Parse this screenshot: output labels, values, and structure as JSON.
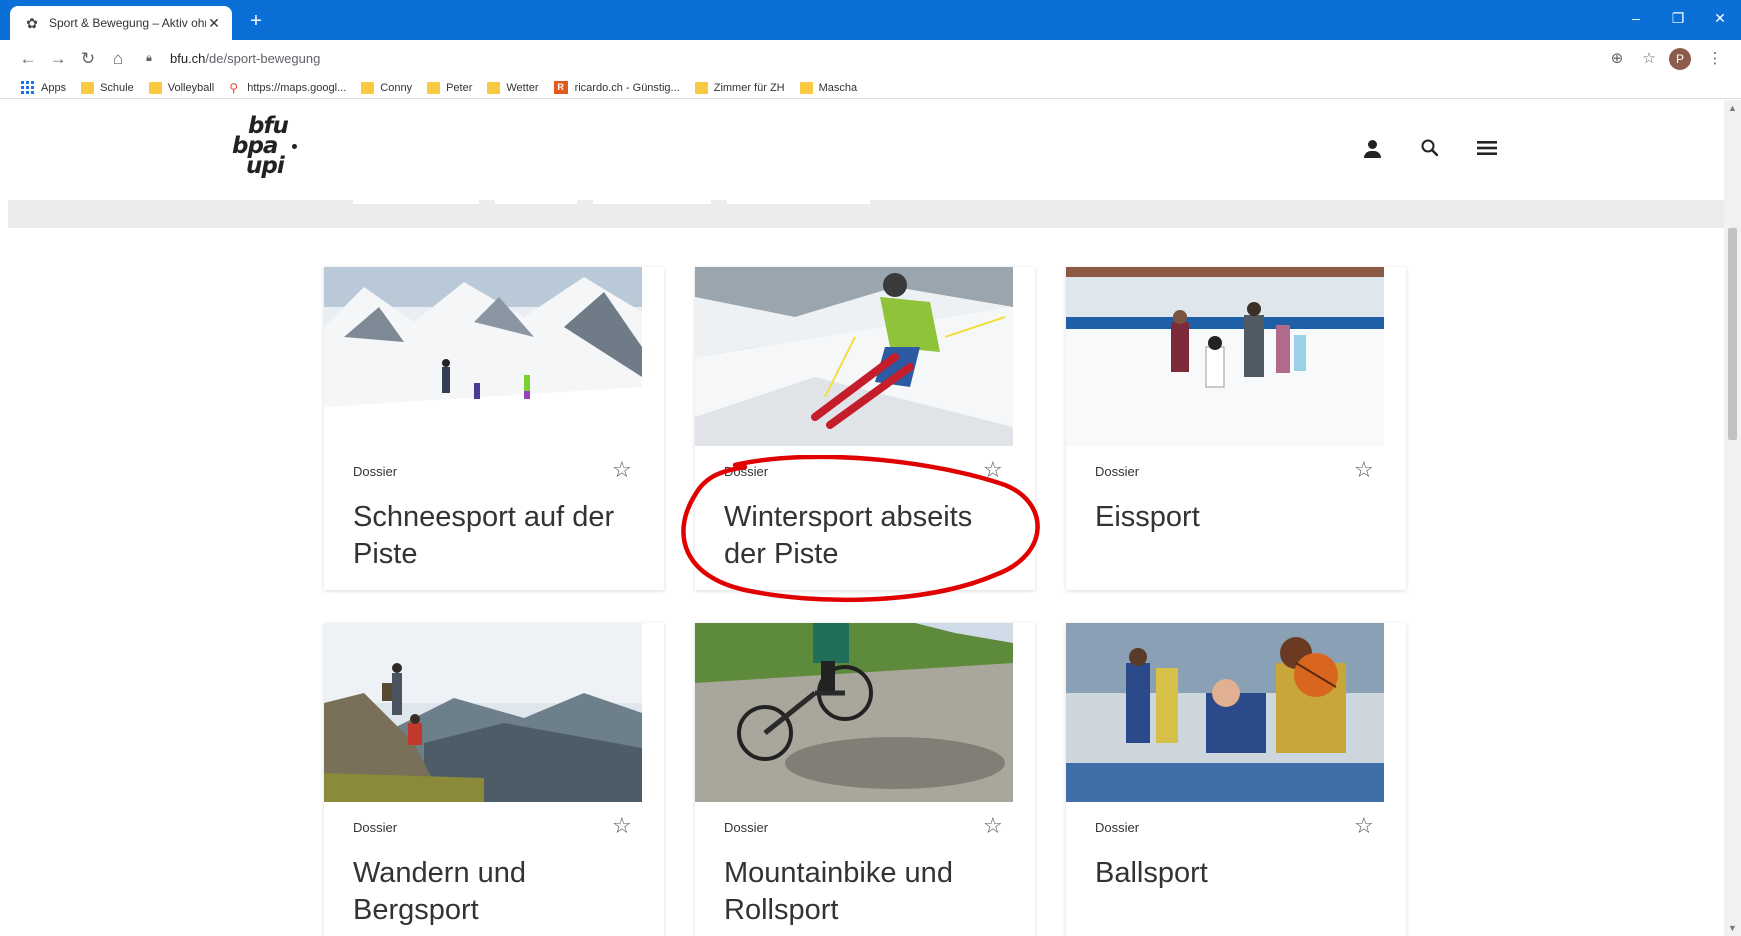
{
  "browser": {
    "tab_title": "Sport & Bewegung – Aktiv ohne",
    "tab_close": "✕",
    "new_tab": "+",
    "window": {
      "minimize": "–",
      "restore": "❐",
      "close": "✕"
    },
    "url_host": "bfu.ch",
    "url_path": "/de/sport-bewegung",
    "profile_initial": "P",
    "bookmarks": [
      {
        "label": "Apps",
        "icon": "apps-grid-icon"
      },
      {
        "label": "Schule",
        "icon": "folder-icon"
      },
      {
        "label": "Volleyball",
        "icon": "folder-icon"
      },
      {
        "label": "https://maps.googl...",
        "icon": "maps-pin-icon"
      },
      {
        "label": "Conny",
        "icon": "folder-icon"
      },
      {
        "label": "Peter",
        "icon": "folder-icon"
      },
      {
        "label": "Wetter",
        "icon": "folder-icon"
      },
      {
        "label": "ricardo.ch - Günstig...",
        "icon": "ricardo-icon"
      },
      {
        "label": "Zimmer für ZH",
        "icon": "folder-icon"
      },
      {
        "label": "Mascha",
        "icon": "folder-icon"
      }
    ]
  },
  "site": {
    "logo": {
      "line1": "bfu",
      "line2": "bpa",
      "line3": "upi"
    },
    "icons": [
      "user-icon",
      "search-icon",
      "menu-icon"
    ]
  },
  "cards": [
    {
      "category": "Dossier",
      "title": "Schneesport auf der Piste",
      "image": "family-skiing-slope"
    },
    {
      "category": "Dossier",
      "title": "Wintersport abseits der Piste",
      "image": "freeride-skier"
    },
    {
      "category": "Dossier",
      "title": "Eissport",
      "image": "family-ice-skating"
    },
    {
      "category": "Dossier",
      "title": "Wandern und Bergsport",
      "image": "hikers-mountain-view"
    },
    {
      "category": "Dossier",
      "title": "Mountainbike und Rollsport",
      "image": "mountain-biker-pumptrack"
    },
    {
      "category": "Dossier",
      "title": "Ballsport",
      "image": "basketball-players"
    }
  ],
  "colors": {
    "tabbar": "#0a6fd6",
    "annotation": "#e00000",
    "band": "#ececec"
  }
}
